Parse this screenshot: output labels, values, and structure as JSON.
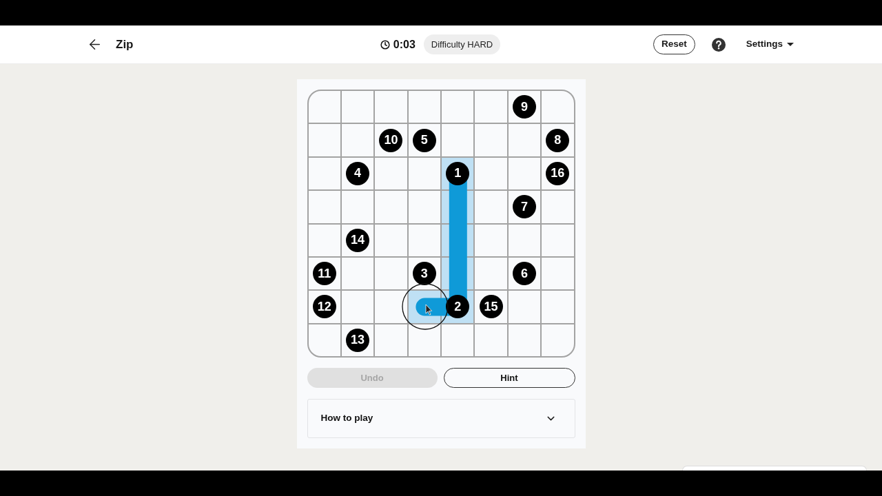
{
  "header": {
    "title": "Zip",
    "timer": "0:03",
    "difficulty": "Difficulty HARD",
    "reset_button": "Reset",
    "settings_menu": "Settings"
  },
  "grid": {
    "rows": [
      {
        "cells": [
          {
            "visited": false,
            "cursor": false
          },
          {
            "visited": false,
            "cursor": false
          },
          {
            "visited": false,
            "cursor": false
          },
          {
            "visited": false,
            "cursor": false
          },
          {
            "visited": false,
            "cursor": false
          },
          {
            "visited": false,
            "cursor": false
          },
          {
            "number": "9",
            "visited": false,
            "cursor": false
          },
          {
            "visited": false,
            "cursor": false
          }
        ]
      },
      {
        "cells": [
          {
            "visited": false,
            "cursor": false
          },
          {
            "visited": false,
            "cursor": false
          },
          {
            "number": "10",
            "visited": false,
            "cursor": false
          },
          {
            "number": "5",
            "visited": false,
            "cursor": false
          },
          {
            "visited": false,
            "cursor": false
          },
          {
            "visited": false,
            "cursor": false
          },
          {
            "visited": false,
            "cursor": false
          },
          {
            "number": "8",
            "visited": false,
            "cursor": false
          }
        ]
      },
      {
        "cells": [
          {
            "visited": false,
            "cursor": false
          },
          {
            "number": "4",
            "visited": false,
            "cursor": false
          },
          {
            "visited": false,
            "cursor": false
          },
          {
            "visited": false,
            "cursor": false
          },
          {
            "number": "1",
            "visited": true,
            "cursor": false
          },
          {
            "visited": false,
            "cursor": false
          },
          {
            "visited": false,
            "cursor": false
          },
          {
            "number": "16",
            "visited": false,
            "cursor": false
          }
        ]
      },
      {
        "cells": [
          {
            "visited": false,
            "cursor": false
          },
          {
            "visited": false,
            "cursor": false
          },
          {
            "visited": false,
            "cursor": false
          },
          {
            "visited": false,
            "cursor": false
          },
          {
            "visited": true,
            "cursor": false
          },
          {
            "visited": false,
            "cursor": false
          },
          {
            "number": "7",
            "visited": false,
            "cursor": false
          },
          {
            "visited": false,
            "cursor": false
          }
        ]
      },
      {
        "cells": [
          {
            "visited": false,
            "cursor": false
          },
          {
            "number": "14",
            "visited": false,
            "cursor": false
          },
          {
            "visited": false,
            "cursor": false
          },
          {
            "visited": false,
            "cursor": false
          },
          {
            "visited": true,
            "cursor": false
          },
          {
            "visited": false,
            "cursor": false
          },
          {
            "visited": false,
            "cursor": false
          },
          {
            "visited": false,
            "cursor": false
          }
        ]
      },
      {
        "cells": [
          {
            "number": "11",
            "visited": false,
            "cursor": false
          },
          {
            "visited": false,
            "cursor": false
          },
          {
            "visited": false,
            "cursor": false
          },
          {
            "number": "3",
            "visited": false,
            "cursor": false
          },
          {
            "visited": true,
            "cursor": false
          },
          {
            "visited": false,
            "cursor": false
          },
          {
            "number": "6",
            "visited": false,
            "cursor": false
          },
          {
            "visited": false,
            "cursor": false
          }
        ]
      },
      {
        "cells": [
          {
            "number": "12",
            "visited": false,
            "cursor": false
          },
          {
            "visited": false,
            "cursor": false
          },
          {
            "visited": false,
            "cursor": false
          },
          {
            "visited": true,
            "cursor": true
          },
          {
            "number": "2",
            "visited": true,
            "cursor": false
          },
          {
            "number": "15",
            "visited": false,
            "cursor": false
          },
          {
            "visited": false,
            "cursor": false
          },
          {
            "visited": false,
            "cursor": false
          }
        ]
      },
      {
        "cells": [
          {
            "visited": false,
            "cursor": false
          },
          {
            "number": "13",
            "visited": false,
            "cursor": false
          },
          {
            "visited": false,
            "cursor": false
          },
          {
            "visited": false,
            "cursor": false
          },
          {
            "visited": false,
            "cursor": false
          },
          {
            "visited": false,
            "cursor": false
          },
          {
            "visited": false,
            "cursor": false
          },
          {
            "visited": false,
            "cursor": false
          }
        ]
      }
    ]
  },
  "actions": [
    {
      "label": "Undo",
      "disabled": true
    },
    {
      "label": "Hint",
      "disabled": false
    }
  ],
  "how_to_play": {
    "label": "How to play",
    "expanded": false
  }
}
